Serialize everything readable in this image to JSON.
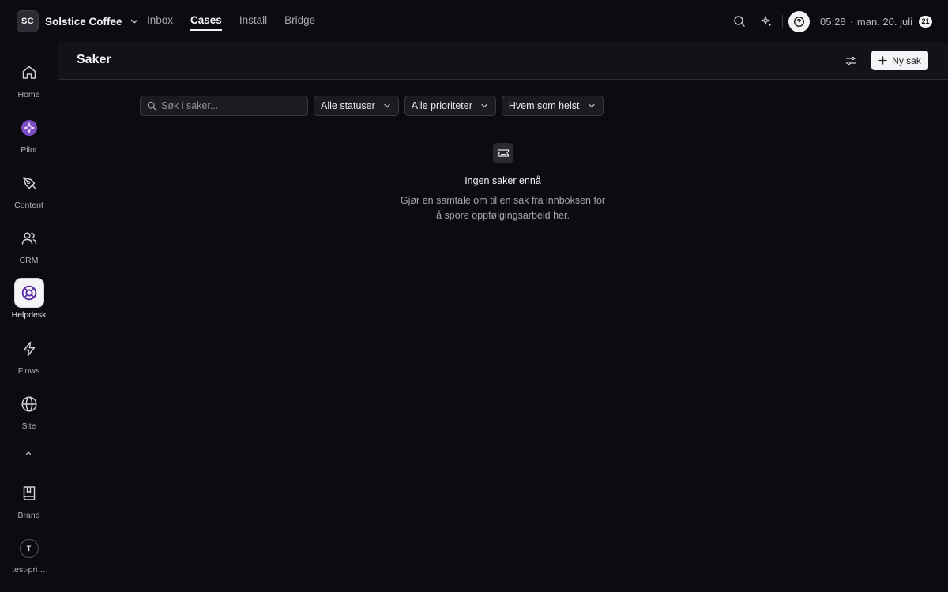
{
  "workspace": {
    "initials": "SC",
    "name": "Solstice Coffee"
  },
  "topnav": [
    {
      "label": "Inbox",
      "active": false
    },
    {
      "label": "Cases",
      "active": true
    },
    {
      "label": "Install",
      "active": false
    },
    {
      "label": "Bridge",
      "active": false
    }
  ],
  "clock": {
    "time": "05:28",
    "separator": "·",
    "date": "man. 20. juli",
    "badge": "21"
  },
  "sidebar": {
    "items": [
      {
        "label": "Home",
        "icon": "home-icon",
        "active": false
      },
      {
        "label": "Pilot",
        "icon": "pilot-icon",
        "active": false
      },
      {
        "label": "Content",
        "icon": "pen-icon",
        "active": false
      },
      {
        "label": "CRM",
        "icon": "users-icon",
        "active": false
      },
      {
        "label": "Helpdesk",
        "icon": "lifebuoy-icon",
        "active": true
      },
      {
        "label": "Flows",
        "icon": "lightning-icon",
        "active": false
      },
      {
        "label": "Site",
        "icon": "globe-icon",
        "active": false
      }
    ],
    "brand_label": "Brand",
    "user_initial": "T",
    "user_label": "test-pri…"
  },
  "page": {
    "title": "Saker",
    "new_button_label": "Ny sak"
  },
  "search": {
    "placeholder": "Søk i saker...",
    "value": ""
  },
  "filters": {
    "status": "Alle statuser",
    "priority": "Alle prioriteter",
    "assignee": "Hvem som helst"
  },
  "empty_state": {
    "title": "Ingen saker ennå",
    "description": "Gjør en samtale om til en sak fra innboksen for å spore oppfølgingsarbeid her."
  },
  "colors": {
    "background": "#0c0b11",
    "header": "#131218",
    "accent": "#7c4dc4"
  }
}
